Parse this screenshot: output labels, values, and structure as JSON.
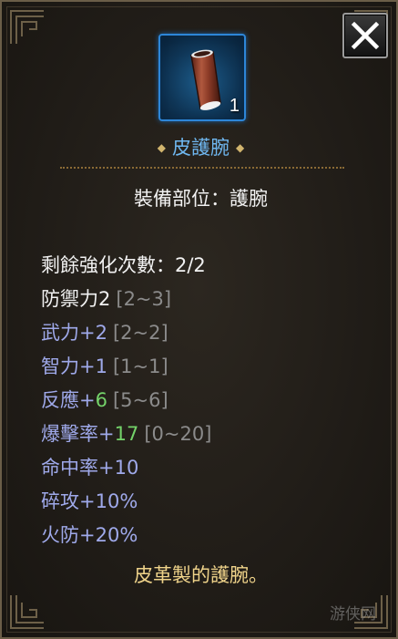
{
  "close_button": {
    "icon": "close-icon"
  },
  "item": {
    "icon": "leather-bracer-icon",
    "count": "1",
    "name": "皮護腕",
    "slot_text": "裝備部位：護腕",
    "refine_text": "剩餘強化次數：2/2",
    "description": "皮革製的護腕。"
  },
  "stats": [
    {
      "name": "防禦力",
      "prefix": "",
      "value": "2",
      "range": "[2~3]",
      "name_color": "white",
      "value_color": "white"
    },
    {
      "name": "武力",
      "prefix": "+",
      "value": "2",
      "range": "[2~2]",
      "name_color": "blue",
      "value_color": "blue"
    },
    {
      "name": "智力",
      "prefix": "+",
      "value": "1",
      "range": "[1~1]",
      "name_color": "blue",
      "value_color": "blue"
    },
    {
      "name": "反應",
      "prefix": "+",
      "value": "6",
      "range": "[5~6]",
      "name_color": "blue",
      "value_color": "green"
    },
    {
      "name": "爆擊率",
      "prefix": "+",
      "value": "17",
      "range": "[0~20]",
      "name_color": "blue",
      "value_color": "green"
    },
    {
      "name": "命中率",
      "prefix": "+",
      "value": "10",
      "range": "",
      "name_color": "blue",
      "value_color": "blue"
    },
    {
      "name": "碎攻",
      "prefix": "+",
      "value": "10%",
      "range": "",
      "name_color": "blue",
      "value_color": "blue"
    },
    {
      "name": "火防",
      "prefix": "+",
      "value": "20%",
      "range": "",
      "name_color": "blue",
      "value_color": "blue"
    }
  ],
  "decoration": {
    "diamond_left": "◆",
    "diamond_right": "◆"
  },
  "watermark": "游侠网",
  "colors": {
    "name_blue": "#6fb7f0",
    "stat_blue": "#9fa9ea",
    "bonus_green": "#74d36a",
    "gold": "#efd38a",
    "range_gray": "#8b8b8b"
  }
}
